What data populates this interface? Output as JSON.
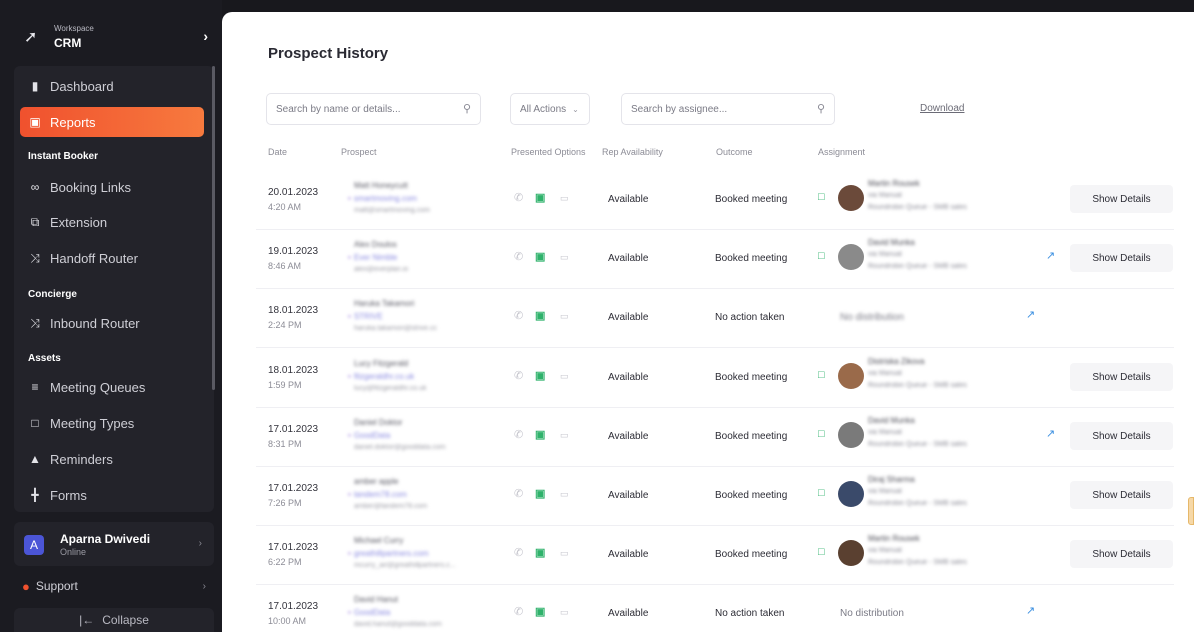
{
  "workspace": {
    "label": "Workspace",
    "name": "CRM"
  },
  "nav": {
    "dashboard": "Dashboard",
    "reports": "Reports",
    "section_instant": "Instant Booker",
    "booking_links": "Booking Links",
    "extension": "Extension",
    "handoff_router": "Handoff Router",
    "section_concierge": "Concierge",
    "inbound_router": "Inbound Router",
    "section_assets": "Assets",
    "meeting_queues": "Meeting Queues",
    "meeting_types": "Meeting Types",
    "reminders": "Reminders",
    "forms": "Forms"
  },
  "user": {
    "initial": "A",
    "name": "Aparna Dwivedi",
    "status": "Online"
  },
  "support": "Support",
  "collapse": "Collapse",
  "page": {
    "title": "Prospect History",
    "search_placeholder": "Search by name or details...",
    "actions_select": "All Actions",
    "assignee_placeholder": "Search by assignee...",
    "download": "Download"
  },
  "columns": {
    "date": "Date",
    "prospect": "Prospect",
    "options": "Presented Options",
    "availability": "Rep Availability",
    "outcome": "Outcome",
    "assignment": "Assignment"
  },
  "show_details_label": "Show Details",
  "rows": [
    {
      "date": "20.01.2023",
      "time": "4:20 AM",
      "name": "Matt Honeycutt",
      "company": "smartmoving.com",
      "email": "matt@smartmoving.com",
      "availability": "Available",
      "outcome": "Booked meeting",
      "assignee": "Martin Rousek",
      "via": "via Manual",
      "queue": "Roundrobin Queue - SMB sales"
    },
    {
      "date": "19.01.2023",
      "time": "8:46 AM",
      "name": "Alex Doulos",
      "company": "Ever Nimble",
      "email": "alex@everplan.io",
      "availability": "Available",
      "outcome": "Booked meeting",
      "assignee": "David Munka",
      "via": "via Manual",
      "queue": "Roundrobin Queue - SMB sales"
    },
    {
      "date": "18.01.2023",
      "time": "2:24 PM",
      "name": "Haruka Takamori",
      "company": "STRIVE",
      "email": "haruka.takamori@strive.cc",
      "availability": "Available",
      "outcome": "No action taken",
      "nodist": "No distribution"
    },
    {
      "date": "18.01.2023",
      "time": "1:59 PM",
      "name": "Lucy Fitzgerald",
      "company": "fitzgeraldhr.co.uk",
      "email": "lucy@fitzgeraldhr.co.uk",
      "availability": "Available",
      "outcome": "Booked meeting",
      "assignee": "Distriska Zikova",
      "via": "via Manual",
      "queue": "Roundrobin Queue - SMB sales"
    },
    {
      "date": "17.01.2023",
      "time": "8:31 PM",
      "name": "Daniel Doktor",
      "company": "GoodData",
      "email": "daniel.doktor@gooddata.com",
      "availability": "Available",
      "outcome": "Booked meeting",
      "assignee": "David Munka",
      "via": "via Manual",
      "queue": "Roundrobin Queue - SMB sales"
    },
    {
      "date": "17.01.2023",
      "time": "7:26 PM",
      "name": "amber apple",
      "company": "tandem78.com",
      "email": "amber@tandem78.com",
      "availability": "Available",
      "outcome": "Booked meeting",
      "assignee": "Diraj Sharma",
      "via": "via Manual",
      "queue": "Roundrobin Queue - SMB sales"
    },
    {
      "date": "17.01.2023",
      "time": "6:22 PM",
      "name": "Michael Curry",
      "company": "greathillpartners.com",
      "email": "mcurry_air@greathillpartners.c...",
      "availability": "Available",
      "outcome": "Booked meeting",
      "assignee": "Martin Rousek",
      "via": "via Manual",
      "queue": "Roundrobin Queue - SMB sales"
    },
    {
      "date": "17.01.2023",
      "time": "10:00 AM",
      "name": "David Hanut",
      "company": "GoodData",
      "email": "david.hanut@gooddata.com",
      "availability": "Available",
      "outcome": "No action taken",
      "nodist": "No distribution"
    }
  ]
}
